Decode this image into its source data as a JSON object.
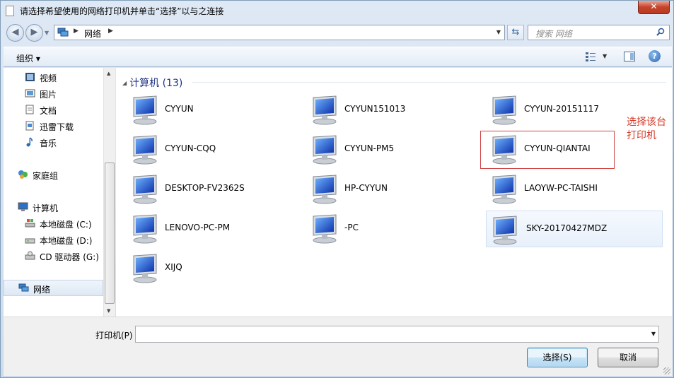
{
  "window": {
    "title": "请选择希望使用的网络打印机并单击“选择”以与之连接",
    "close_label": "✕"
  },
  "address": {
    "path": "网络",
    "search_placeholder": "搜索 网络"
  },
  "toolbar": {
    "organize_label": "组织 ▾"
  },
  "sidebar": {
    "items": [
      {
        "label": "视频",
        "icon": "video-icon"
      },
      {
        "label": "图片",
        "icon": "pictures-icon"
      },
      {
        "label": "文档",
        "icon": "documents-icon"
      },
      {
        "label": "迅雷下载",
        "icon": "download-icon"
      },
      {
        "label": "音乐",
        "icon": "music-icon"
      },
      {
        "label": "家庭组",
        "icon": "homegroup-icon"
      },
      {
        "label": "计算机",
        "icon": "computer-icon"
      },
      {
        "label": "本地磁盘 (C:)",
        "icon": "drive-c-icon"
      },
      {
        "label": "本地磁盘 (D:)",
        "icon": "drive-icon"
      },
      {
        "label": "CD 驱动器 (G:)",
        "icon": "cd-drive-icon"
      },
      {
        "label": "网络",
        "icon": "network-icon",
        "selected": true
      }
    ]
  },
  "content": {
    "group_header": "计算机 (13)",
    "computers": [
      "CYYUN",
      "CYYUN151013",
      "CYYUN-20151117",
      "CYYUN-CQQ",
      "CYYUN-PM5",
      "CYYUN-QIANTAI",
      "DESKTOP-FV2362S",
      "HP-CYYUN",
      "LAOYW-PC-TAISHI",
      "LENOVO-PC-PM",
      "-PC",
      "SKY-20170427MDZ",
      "XIJQ"
    ],
    "annotation": "选择该台打印机",
    "annotation_color": "#d63b2a"
  },
  "footer": {
    "printer_label": "打印机(P)",
    "printer_value": "",
    "select_button": "选择(S)",
    "cancel_button": "取消"
  }
}
